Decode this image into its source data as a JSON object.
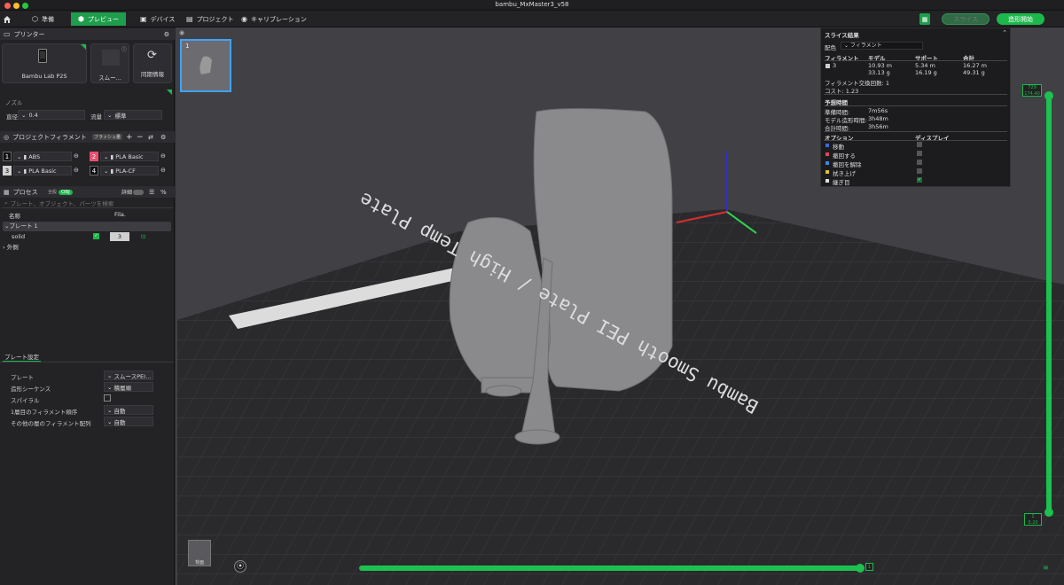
{
  "window": {
    "title": "bambu_MxMaster3_v58"
  },
  "menu": {
    "home_icon": "home-icon",
    "tabs": [
      {
        "label": "準備",
        "icon": "cube-icon"
      },
      {
        "label": "プレビュー",
        "icon": "preview-icon"
      },
      {
        "label": "デバイス",
        "icon": "device-icon"
      },
      {
        "label": "プロジェクト",
        "icon": "project-icon"
      },
      {
        "label": "キャリブレーション",
        "icon": "calibration-icon"
      }
    ],
    "slice_label": "スライス",
    "print_label": "造形開始"
  },
  "printer": {
    "section_title": "プリンター",
    "printer_name": "Bambu Lab P2S",
    "plate_label": "スムー...",
    "sync_label": "同期情報"
  },
  "nozzle": {
    "title": "ノズル",
    "diameter_label": "直径",
    "diameter_value": "0.4",
    "flow_label": "流量",
    "flow_value": "標準"
  },
  "filament": {
    "title": "プロジェクトフィラメント",
    "badge": "フラッシュ量",
    "items": [
      {
        "num": "1",
        "name": "ABS",
        "color": "#111111"
      },
      {
        "num": "2",
        "name": "PLA Basic",
        "color": "#e8506e"
      },
      {
        "num": "3",
        "name": "PLA Basic",
        "color": "#d0d0d0"
      },
      {
        "num": "4",
        "name": "PLA-CF",
        "color": "#111111"
      }
    ]
  },
  "process": {
    "title": "プロセス",
    "toggle_left": "全般",
    "toggle_right": "OBJ",
    "detail_label": "詳細",
    "search_placeholder": "プレート、オブジェクト、パーツを検索",
    "col_name": "名称",
    "col_fila": "Fila.",
    "plate_row": "プレート 1",
    "object_row": "solid",
    "object_fila": "3",
    "outside_row": "外側"
  },
  "plate_settings": {
    "tab": "プレート設定",
    "rows": [
      {
        "label": "プレート",
        "value": "スムースPEI..."
      },
      {
        "label": "造形シーケンス",
        "value": "積層順"
      },
      {
        "label": "スパイラル",
        "value": ""
      },
      {
        "label": "1層目のフィラメント順序",
        "value": "自動"
      },
      {
        "label": "その他の層のフィラメント配列",
        "value": "自動"
      }
    ]
  },
  "viewport": {
    "thumb_index": "1",
    "bed_text": "Bambu Smooth PEI Plate / High Temp Plate",
    "view_label": "背面",
    "layer_top": "729",
    "layer_top_height": "174.40",
    "layer_bottom": "1",
    "layer_bottom_height": "0.20",
    "move_value": "1"
  },
  "slice_result": {
    "title": "スライス結果",
    "color_label": "配色",
    "color_value": "フィラメント",
    "headers": [
      "フィラメント",
      "モデル",
      "サポート",
      "合計"
    ],
    "row": {
      "filament": "3",
      "model_len": "10.93 m",
      "model_wt": "33.13 g",
      "support_len": "5.34 m",
      "support_wt": "16.19 g",
      "total_len": "16.27 m",
      "total_wt": "49.31 g"
    },
    "change_count": "フィラメント交換回数:  1",
    "cost": "コスト:  1.23",
    "time_title": "予想時間",
    "time_rows": [
      {
        "label": "準備時間:",
        "value": "7m56s"
      },
      {
        "label": "モデル造形時間:",
        "value": "3h48m"
      },
      {
        "label": "合計時間:",
        "value": "3h56m"
      }
    ],
    "options_title": "オプション",
    "display_title": "ディスプレイ",
    "options": [
      {
        "label": "移動",
        "color": "#3a6ad8",
        "checked": false
      },
      {
        "label": "撤回する",
        "color": "#d84a5a",
        "checked": false
      },
      {
        "label": "撤回を解除",
        "color": "#3a8ad8",
        "checked": false
      },
      {
        "label": "拭き上げ",
        "color": "#e0c030",
        "checked": false
      },
      {
        "label": "継ぎ目",
        "color": "#e0e0e0",
        "checked": true
      }
    ]
  }
}
